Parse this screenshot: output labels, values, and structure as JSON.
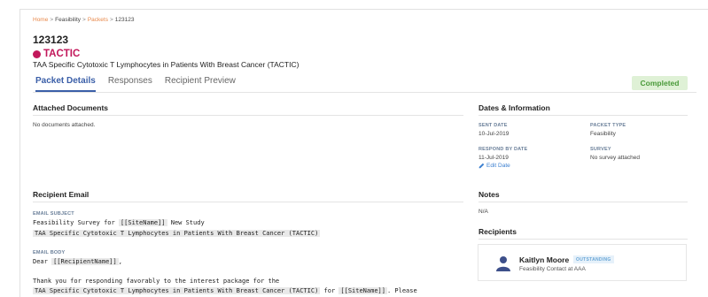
{
  "breadcrumb": {
    "home": "Home",
    "feasibility": "Feasibility",
    "packets": "Packets",
    "current": "123123",
    "separator": ">"
  },
  "page": {
    "title": "123123",
    "study_code": "TACTIC",
    "study_name": "TAA Specific Cytotoxic T Lymphocytes in Patients With Breast Cancer (TACTIC)"
  },
  "tabs": [
    {
      "label": "Packet Details",
      "active": true
    },
    {
      "label": "Responses",
      "active": false
    },
    {
      "label": "Recipient Preview",
      "active": false
    }
  ],
  "status": {
    "label": "Completed",
    "color": "#4a9a3a"
  },
  "attached_documents": {
    "title": "Attached Documents",
    "empty_text": "No documents attached."
  },
  "dates_info": {
    "title": "Dates & Information",
    "sent_date_label": "SENT DATE",
    "sent_date": "10-Jul-2019",
    "packet_type_label": "PACKET TYPE",
    "packet_type": "Feasibility",
    "respond_by_label": "RESPOND BY DATE",
    "respond_by": "11-Jul-2019",
    "edit_date": "Edit Date",
    "survey_label": "SURVEY",
    "survey": "No survey attached"
  },
  "recipient_email": {
    "title": "Recipient Email",
    "subject_label": "EMAIL SUBJECT",
    "subject_line1_prefix": "Feasibility Survey for",
    "subject_line1_token": "[[SiteName]]",
    "subject_line1_suffix": "New Study",
    "subject_line2_token": "TAA Specific Cytotoxic T Lymphocytes in Patients With Breast Cancer (TACTIC)",
    "body_label": "EMAIL BODY",
    "body_dear": "Dear",
    "body_recipient_token": "[[RecipientName]]",
    "body_comma": ",",
    "body_line2": "Thank you for responding favorably to the interest package for the",
    "body_line3_token1": "TAA Specific Cytotoxic T Lymphocytes in Patients With Breast Cancer (TACTIC)",
    "body_line3_for": "for",
    "body_line3_token2": "[[SiteName]]",
    "body_line3_suffix": ".  Please"
  },
  "notes": {
    "title": "Notes",
    "value": "N/A"
  },
  "recipients": {
    "title": "Recipients",
    "items": [
      {
        "name": "Kaitlyn Moore",
        "status": "OUTSTANDING",
        "role": "Feasibility Contact at AAA"
      }
    ]
  },
  "colors": {
    "accent": "#3b5fa8",
    "study": "#c2185b",
    "breadcrumb_link": "#e8884a",
    "status_bg": "#dff1d6"
  }
}
